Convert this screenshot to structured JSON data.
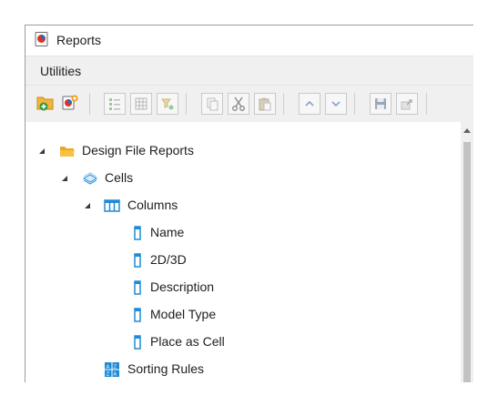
{
  "window": {
    "title": "Reports",
    "title_icon": "reports-app-icon"
  },
  "menubar": {
    "items": [
      {
        "label": "Utilities"
      }
    ]
  },
  "toolbar": {
    "buttons": [
      {
        "name": "add-folder-button",
        "icon": "folder-add-icon"
      },
      {
        "name": "new-report-button",
        "icon": "report-add-icon"
      },
      {
        "name": "list-view-button",
        "icon": "list-icon"
      },
      {
        "name": "grid-view-button",
        "icon": "grid-icon"
      },
      {
        "name": "filter-button",
        "icon": "filter-icon"
      },
      {
        "name": "copy-button",
        "icon": "copy-icon"
      },
      {
        "name": "cut-button",
        "icon": "scissors-icon"
      },
      {
        "name": "paste-button",
        "icon": "paste-icon"
      },
      {
        "name": "move-up-button",
        "icon": "chevron-up-icon"
      },
      {
        "name": "move-down-button",
        "icon": "chevron-down-icon"
      },
      {
        "name": "save-button",
        "icon": "save-icon"
      },
      {
        "name": "export-button",
        "icon": "export-icon"
      }
    ]
  },
  "tree": {
    "nodes": [
      {
        "label": "Design File Reports",
        "level": 0,
        "icon": "folder-icon",
        "expanded": true
      },
      {
        "label": "Cells",
        "level": 1,
        "icon": "cells-icon",
        "expanded": true
      },
      {
        "label": "Columns",
        "level": 2,
        "icon": "columns-icon",
        "expanded": true
      },
      {
        "label": "Name",
        "level": 3,
        "icon": "column-icon"
      },
      {
        "label": "2D/3D",
        "level": 3,
        "icon": "column-icon"
      },
      {
        "label": "Description",
        "level": 3,
        "icon": "column-icon"
      },
      {
        "label": "Model Type",
        "level": 3,
        "icon": "column-icon"
      },
      {
        "label": "Place as Cell",
        "level": 3,
        "icon": "column-icon"
      },
      {
        "label": "Sorting Rules",
        "level": 2,
        "icon": "sorting-rules-icon"
      }
    ]
  },
  "colors": {
    "accent_blue": "#1e8bd6",
    "folder_yellow": "#f6c244",
    "window_bg": "#f0f0f0"
  }
}
